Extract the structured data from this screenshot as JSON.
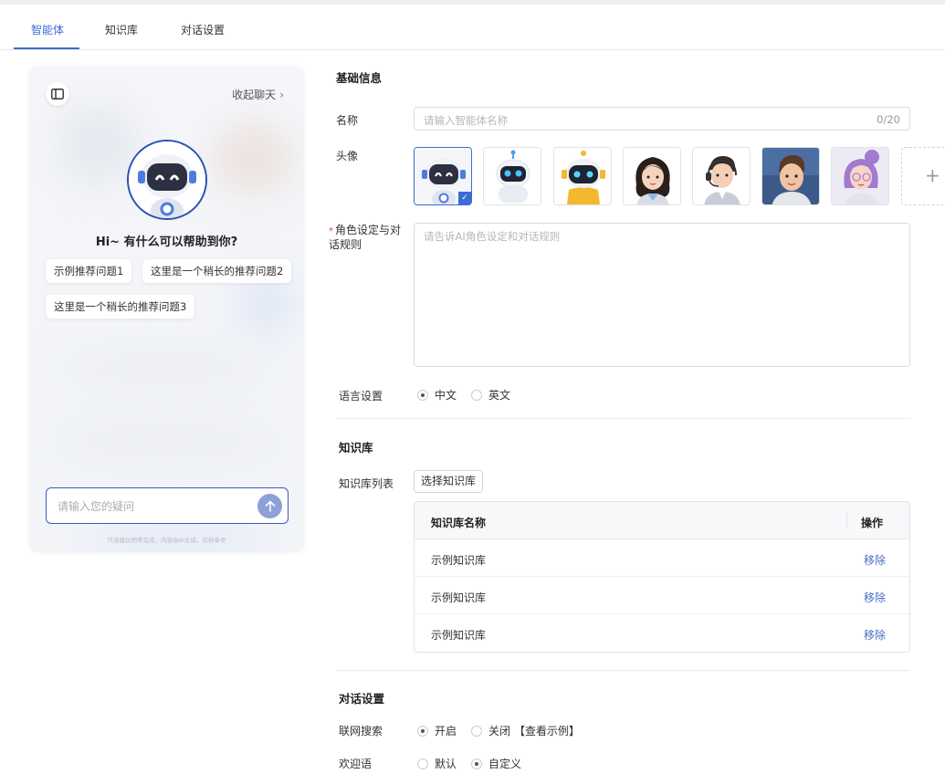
{
  "tabs": [
    {
      "label": "智能体"
    },
    {
      "label": "知识库"
    },
    {
      "label": "对话设置"
    }
  ],
  "preview": {
    "collapse_label": "收起聊天",
    "greeting": "Hi~ 有什么可以帮助到你?",
    "suggestions": [
      "示例推荐问题1",
      "这里是一个稍长的推荐问题2",
      "这里是一个稍长的推荐问题3"
    ],
    "input_placeholder": "请输入您的疑问",
    "disclaimer": "只读建议稍等完成，内容由AI生成，仅供参考"
  },
  "basic": {
    "section_title": "基础信息",
    "name_label": "名称",
    "name_placeholder": "请输入智能体名称",
    "name_counter": "0/20",
    "avatar_label": "头像",
    "avatar_options": [
      "robot-blue",
      "robot-white",
      "robot-yellow",
      "woman-avatar",
      "man-headset",
      "man-casual",
      "woman-purple"
    ],
    "avatar_selected_index": 0,
    "role_label": "角色设定与对话规则",
    "role_required_mark": "*",
    "role_placeholder": "请告诉AI角色设定和对话规则",
    "language_label": "语言设置",
    "language_options": [
      "中文",
      "英文"
    ],
    "language_selected": "中文"
  },
  "knowledge": {
    "section_title": "知识库",
    "list_label": "知识库列表",
    "select_button": "选择知识库",
    "columns": [
      "知识库名称",
      "操作"
    ],
    "rows": [
      {
        "name": "示例知识库",
        "action": "移除"
      },
      {
        "name": "示例知识库",
        "action": "移除"
      },
      {
        "name": "示例知识库",
        "action": "移除"
      }
    ]
  },
  "dialog": {
    "section_title": "对话设置",
    "web_search_label": "联网搜索",
    "web_search_options": [
      "开启",
      "关闭"
    ],
    "web_search_selected": "开启",
    "example_link": "【查看示例】",
    "welcome_label": "欢迎语",
    "welcome_options": [
      "默认",
      "自定义"
    ],
    "welcome_selected": "自定义"
  },
  "colors": {
    "accent": "#3c6bd6",
    "action_link": "#4a6bc4",
    "required": "#e43d3d"
  }
}
